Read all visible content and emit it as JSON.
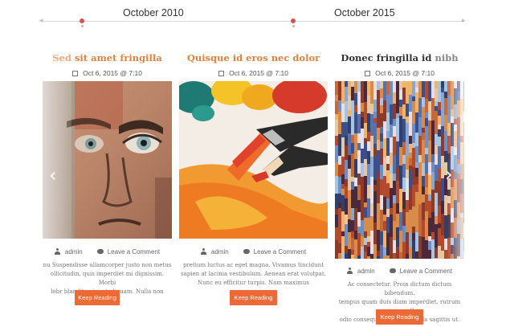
{
  "timeline": {
    "label_left": "October 2010",
    "label_right": "October 2015",
    "arrow_left": "◂",
    "arrow_right": "▸"
  },
  "posts": [
    {
      "title_a": "Sed ",
      "title_b": "sit amet fringilla",
      "date": "Oct 6, 2015 @ 7:10",
      "author": "admin",
      "comments": "Leave a Comment",
      "excerpt": [
        "nu Suspendisse ullamcorper justo non metus",
        "ollicitudin, quis imperdiet mi dignissim. Morbi",
        "lobr blandit enim ut aliquam. Nulla non ipsum"
      ],
      "button": "Keep Reading"
    },
    {
      "title": "Quisque id eros nec dolor",
      "date": "Oct 6, 2015 @ 7:10",
      "author": "admin",
      "comments": "Leave a Comment",
      "excerpt": [
        "pretium luctus ac eget magna. Vivamus tincidunt",
        "sapien at lacinia vestibulum. Aenean erat volutpat.",
        "Nunc eu efficitur turpis. Nam maximus"
      ],
      "button": "Keep Reading"
    },
    {
      "title_a": "Donec fringilla id ",
      "title_b": "nibh",
      "date": "Oct 6, 2015 @ 7:10",
      "author": "admin",
      "comments": "Leave a Comment",
      "excerpt": [
        "Ac consectetur. Proin dictum dictum bibendum.",
        "tempus quam duis diam imperdiet, rutrum purus pell",
        "odio consequat. Donec gravida sagittis ut."
      ],
      "button": "Keep Reading"
    }
  ],
  "colors": {
    "accent": "#ec6a36",
    "title_orange": "#e0823d",
    "title_dark": "#333333",
    "timeline_dot": "#d9534f"
  },
  "icons": {
    "prev": "chevron-left-icon",
    "next": "chevron-right-icon",
    "date": "calendar-icon",
    "author": "user-icon",
    "comments": "comment-icon"
  }
}
